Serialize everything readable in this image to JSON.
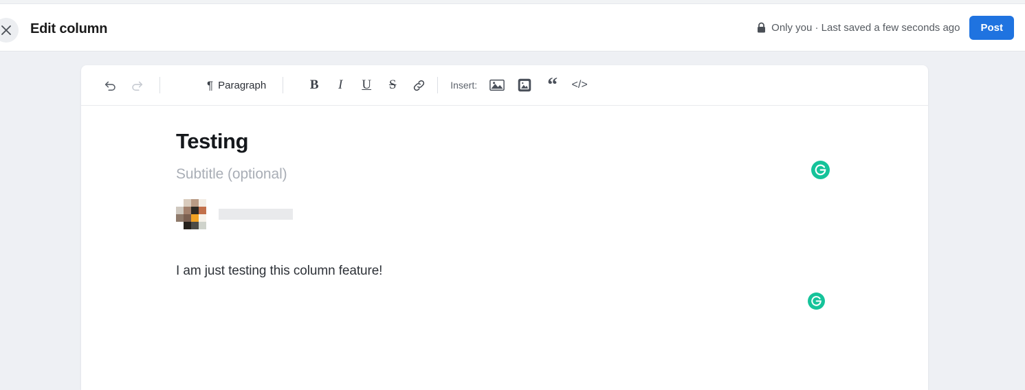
{
  "header": {
    "close_icon": "close-icon",
    "title": "Edit column",
    "lock_icon": "lock-icon",
    "save_status": "Only you · Last saved a few seconds ago",
    "post_label": "Post",
    "post_color": "#1f73e0"
  },
  "toolbar": {
    "undo_icon": "undo-icon",
    "redo_icon": "redo-icon",
    "pilcrow_glyph": "¶",
    "block_type": "Paragraph",
    "bold_label": "B",
    "italic_label": "I",
    "underline_label": "U",
    "strikethrough_label": "S",
    "link_icon": "link-icon",
    "insert_label": "Insert:",
    "insert_banner_icon": "banner-image-icon",
    "insert_photo_icon": "photo-image-icon",
    "quote_glyph": "“",
    "code_glyph": "</>"
  },
  "document": {
    "title": "Testing",
    "subtitle_placeholder": "Subtitle (optional)",
    "avatar_name": "author-avatar",
    "author_name": "",
    "paragraph": "I am just testing this column feature!"
  },
  "grammarly": {
    "icon_name": "grammarly-icon",
    "color": "#15c39a"
  },
  "theme": {
    "page_background": "#eef0f4",
    "card_background": "#ffffff"
  }
}
